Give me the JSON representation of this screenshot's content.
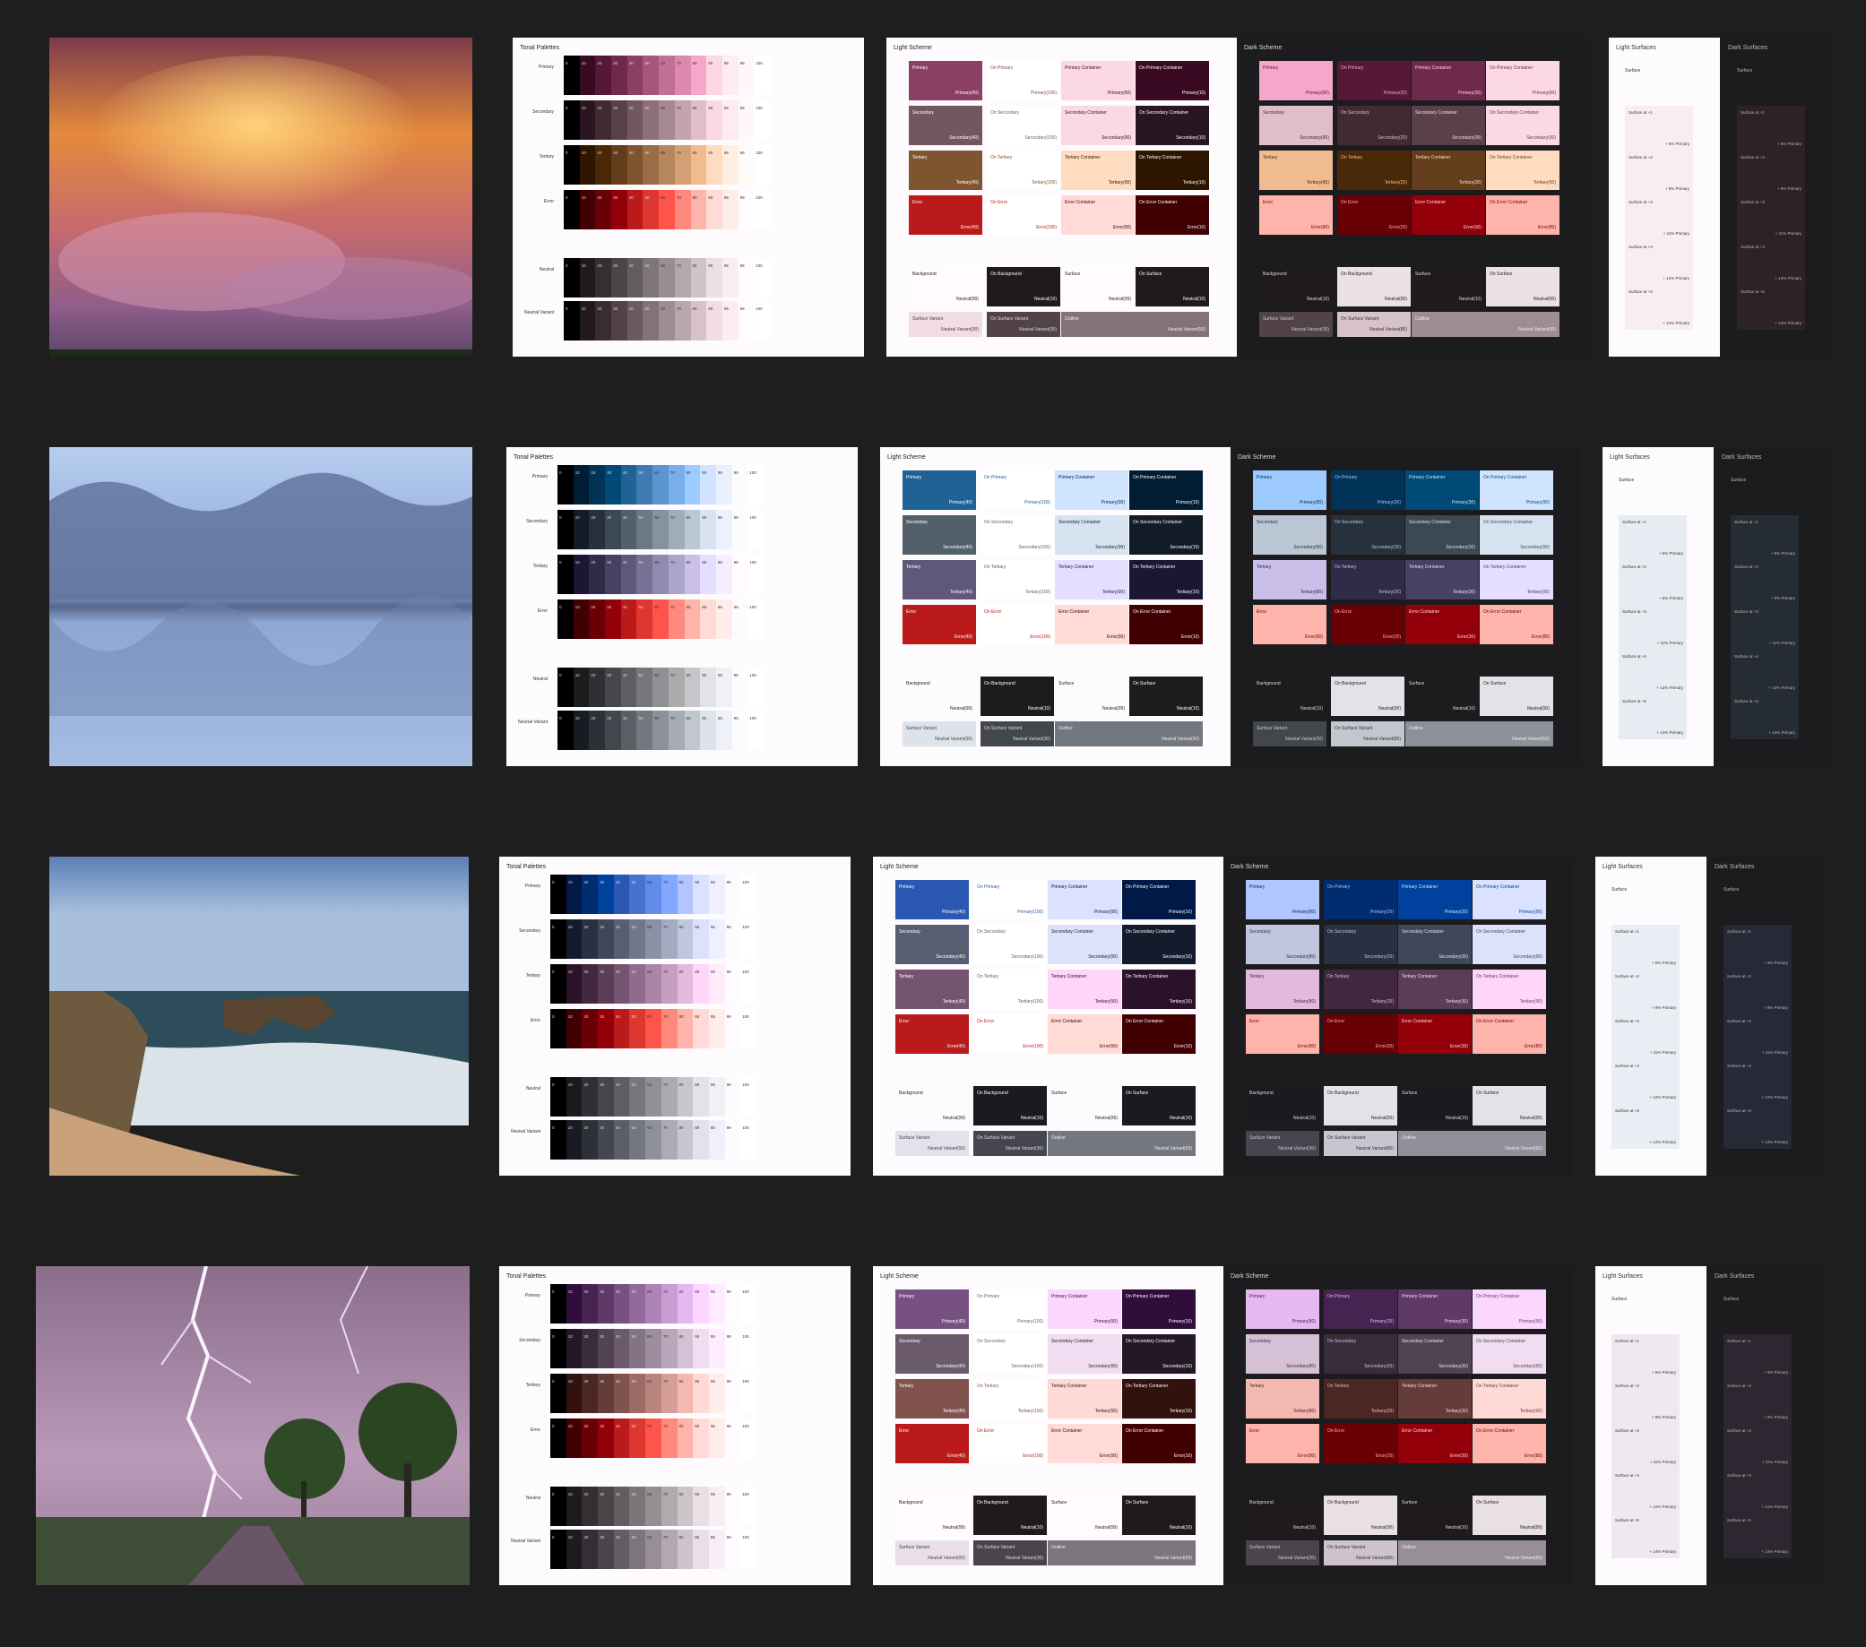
{
  "labels": {
    "tonal_title": "Tonal Palettes",
    "light_scheme_title": "Light Scheme",
    "dark_scheme_title": "Dark Scheme",
    "light_surfaces_title": "Light Surfaces",
    "dark_surfaces_title": "Dark Surfaces",
    "surface": "Surface"
  },
  "tones": [
    "0",
    "10",
    "20",
    "30",
    "40",
    "50",
    "60",
    "70",
    "80",
    "90",
    "95",
    "99",
    "100"
  ],
  "palette_names": [
    "Primary",
    "Secondary",
    "Tertiary",
    "Error",
    "Neutral",
    "Neutral Variant"
  ],
  "surface_levels": [
    {
      "name": "Surface at +1",
      "note": "+ 5% Primary"
    },
    {
      "name": "Surface at +2",
      "note": "+ 8% Primary"
    },
    {
      "name": "Surface at +3",
      "note": "+ 11% Primary"
    },
    {
      "name": "Surface at +4",
      "note": "+ 12% Primary"
    },
    {
      "name": "Surface at +5",
      "note": "+ 14% Primary"
    }
  ],
  "roles_light": [
    {
      "name": "Primary",
      "tone": "Primary(40)"
    },
    {
      "name": "On Primary",
      "tone": "Primary(100)"
    },
    {
      "name": "Primary Container",
      "tone": "Primary(90)"
    },
    {
      "name": "On Primary Container",
      "tone": "Primary(10)"
    },
    {
      "name": "Secondary",
      "tone": "Secondary(40)"
    },
    {
      "name": "On Secondary",
      "tone": "Secondary(100)"
    },
    {
      "name": "Secondary Container",
      "tone": "Secondary(90)"
    },
    {
      "name": "On Secondary Container",
      "tone": "Secondary(10)"
    },
    {
      "name": "Tertiary",
      "tone": "Tertiary(40)"
    },
    {
      "name": "On Tertiary",
      "tone": "Tertiary(100)"
    },
    {
      "name": "Tertiary Container",
      "tone": "Tertiary(90)"
    },
    {
      "name": "On Tertiary Container",
      "tone": "Tertiary(10)"
    },
    {
      "name": "Error",
      "tone": "Error(40)"
    },
    {
      "name": "On Error",
      "tone": "Error(100)"
    },
    {
      "name": "Error Container",
      "tone": "Error(90)"
    },
    {
      "name": "On Error Container",
      "tone": "Error(10)"
    },
    {
      "name": "Background",
      "tone": "Neutral(99)"
    },
    {
      "name": "On Background",
      "tone": "Neutral(10)"
    },
    {
      "name": "Surface",
      "tone": "Neutral(99)"
    },
    {
      "name": "On Surface",
      "tone": "Neutral(10)"
    },
    {
      "name": "Surface Variant",
      "tone": "Neutral Variant(90)"
    },
    {
      "name": "On Surface Variant",
      "tone": "Neutral Variant(30)"
    },
    {
      "name": "Outline",
      "tone": "Neutral Variant(50)"
    }
  ],
  "roles_dark": [
    {
      "name": "Primary",
      "tone": "Primary(80)"
    },
    {
      "name": "On Primary",
      "tone": "Primary(20)"
    },
    {
      "name": "Primary Container",
      "tone": "Primary(30)"
    },
    {
      "name": "On Primary Container",
      "tone": "Primary(90)"
    },
    {
      "name": "Secondary",
      "tone": "Secondary(80)"
    },
    {
      "name": "On Secondary",
      "tone": "Secondary(20)"
    },
    {
      "name": "Secondary Container",
      "tone": "Secondary(30)"
    },
    {
      "name": "On Secondary Container",
      "tone": "Secondary(90)"
    },
    {
      "name": "Tertiary",
      "tone": "Tertiary(80)"
    },
    {
      "name": "On Tertiary",
      "tone": "Tertiary(20)"
    },
    {
      "name": "Tertiary Container",
      "tone": "Tertiary(30)"
    },
    {
      "name": "On Tertiary Container",
      "tone": "Tertiary(90)"
    },
    {
      "name": "Error",
      "tone": "Error(80)"
    },
    {
      "name": "On Error",
      "tone": "Error(20)"
    },
    {
      "name": "Error Container",
      "tone": "Error(30)"
    },
    {
      "name": "On Error Container",
      "tone": "Error(80)"
    },
    {
      "name": "Background",
      "tone": "Neutral(10)"
    },
    {
      "name": "On Background",
      "tone": "Neutral(90)"
    },
    {
      "name": "Surface",
      "tone": "Neutral(10)"
    },
    {
      "name": "On Surface",
      "tone": "Neutral(90)"
    },
    {
      "name": "Surface Variant",
      "tone": "Neutral Variant(30)"
    },
    {
      "name": "On Surface Variant",
      "tone": "Neutral Variant(80)"
    },
    {
      "name": "Outline",
      "tone": "Neutral Variant(60)"
    }
  ],
  "rows": [
    {
      "photo": "sunset-storm-clouds",
      "colors": {
        "primary": [
          "#000000",
          "#3a0a22",
          "#551836",
          "#6f2a4b",
          "#8b3f62",
          "#a6567b",
          "#c26f94",
          "#dd89ae",
          "#f4a7c8",
          "#fbd8e4",
          "#fdecf1",
          "#fff8f9",
          "#ffffff"
        ],
        "secondary": [
          "#000000",
          "#2a1620",
          "#412a34",
          "#59404a",
          "#725761",
          "#8c6f7a",
          "#a78994",
          "#c3a3ae",
          "#dfbec9",
          "#fbd9e4",
          "#fdedf1",
          "#fff8f9",
          "#ffffff"
        ],
        "tertiary": [
          "#000000",
          "#2e1500",
          "#4a2908",
          "#643e1c",
          "#7f5530",
          "#9a6d46",
          "#b6865d",
          "#d3a076",
          "#f0bb8f",
          "#ffdcc0",
          "#ffeee2",
          "#fffbf8",
          "#ffffff"
        ],
        "error": [
          "#000000",
          "#410002",
          "#690005",
          "#93000a",
          "#ba1a1a",
          "#de3730",
          "#ff5449",
          "#ff897d",
          "#ffb4ab",
          "#ffdad6",
          "#ffedea",
          "#fffbff",
          "#ffffff"
        ],
        "neutral": [
          "#000000",
          "#201a1c",
          "#352f31",
          "#4c4547",
          "#645c5f",
          "#7e7577",
          "#988e91",
          "#b3a9ab",
          "#cfc4c6",
          "#ebe0e2",
          "#faeef0",
          "#fffbff",
          "#ffffff"
        ],
        "neutral_variant": [
          "#000000",
          "#23191d",
          "#392d32",
          "#514348",
          "#695b60",
          "#837378",
          "#9e8d92",
          "#b9a7ad",
          "#d6c2c8",
          "#f2dde4",
          "#ffecf1",
          "#fffbff",
          "#ffffff"
        ],
        "light_surface": "#f8eef2",
        "dark_surface": "#2d2326"
      }
    },
    {
      "photo": "frozen-river-trees",
      "colors": {
        "primary": [
          "#000000",
          "#001d34",
          "#003355",
          "#004a78",
          "#1f6296",
          "#3f7bb2",
          "#5c95ce",
          "#78afea",
          "#9dcaff",
          "#d0e4ff",
          "#e9f1ff",
          "#fcfcff",
          "#ffffff"
        ],
        "secondary": [
          "#000000",
          "#111c26",
          "#26313c",
          "#3c4853",
          "#535f6b",
          "#6c7884",
          "#86929e",
          "#a0acb9",
          "#bcc7d5",
          "#d8e3f1",
          "#ebf1ff",
          "#fcfcff",
          "#ffffff"
        ],
        "tertiary": [
          "#000000",
          "#1b1633",
          "#312b4a",
          "#474162",
          "#5f587b",
          "#787195",
          "#928ab0",
          "#ada4cb",
          "#c9bfe8",
          "#e5deff",
          "#f4eeff",
          "#fffbff",
          "#ffffff"
        ],
        "error": [
          "#000000",
          "#410002",
          "#690005",
          "#93000a",
          "#ba1a1a",
          "#de3730",
          "#ff5449",
          "#ff897d",
          "#ffb4ab",
          "#ffdad6",
          "#ffedea",
          "#fcfcff",
          "#ffffff"
        ],
        "neutral": [
          "#000000",
          "#1a1c1e",
          "#2f3033",
          "#45474a",
          "#5d5e61",
          "#76777a",
          "#909094",
          "#ababae",
          "#c6c6ca",
          "#e3e2e6",
          "#f1f0f4",
          "#fcfcff",
          "#ffffff"
        ],
        "neutral_variant": [
          "#000000",
          "#171c22",
          "#2c3138",
          "#42474e",
          "#5a5f66",
          "#73777f",
          "#8c9199",
          "#a7abb3",
          "#c2c7cf",
          "#dee3eb",
          "#eef1fa",
          "#fcfcff",
          "#ffffff"
        ],
        "light_surface": "#e6ecf1",
        "dark_surface": "#252c33"
      }
    },
    {
      "photo": "coastal-rock-arch",
      "colors": {
        "primary": [
          "#000000",
          "#001946",
          "#002c70",
          "#00419d",
          "#2b58b3",
          "#4772ce",
          "#628ce9",
          "#82a7ff",
          "#b1c5ff",
          "#dae2ff",
          "#eef0ff",
          "#fefbff",
          "#ffffff"
        ],
        "secondary": [
          "#000000",
          "#141b2c",
          "#293042",
          "#3f4759",
          "#575e71",
          "#70778b",
          "#8a90a5",
          "#a4abc1",
          "#c0c6dd",
          "#dce2f9",
          "#eef0ff",
          "#fefbff",
          "#ffffff"
        ],
        "tertiary": [
          "#000000",
          "#2b122b",
          "#422741",
          "#5b3d58",
          "#745471",
          "#8f6c8b",
          "#aa85a5",
          "#c69fc0",
          "#e3badc",
          "#ffd6f8",
          "#ffebf9",
          "#fffbff",
          "#ffffff"
        ],
        "error": [
          "#000000",
          "#410002",
          "#690005",
          "#93000a",
          "#ba1a1a",
          "#de3730",
          "#ff5449",
          "#ff897d",
          "#ffb4ab",
          "#ffdad6",
          "#ffedea",
          "#fffbff",
          "#ffffff"
        ],
        "neutral": [
          "#000000",
          "#1b1b1f",
          "#303034",
          "#46464a",
          "#5e5e62",
          "#77767a",
          "#919094",
          "#acaaaf",
          "#c7c6ca",
          "#e4e2e6",
          "#f2f0f4",
          "#fefbff",
          "#ffffff"
        ],
        "neutral_variant": [
          "#000000",
          "#191b23",
          "#2e3038",
          "#45464f",
          "#5c5e67",
          "#757780",
          "#8f909a",
          "#aaabb4",
          "#c5c6d0",
          "#e1e2ec",
          "#f0f0fa",
          "#fefbff",
          "#ffffff"
        ],
        "light_surface": "#ebedf5",
        "dark_surface": "#262a36"
      }
    },
    {
      "photo": "lightning-over-road",
      "colors": {
        "primary": [
          "#000000",
          "#300d3a",
          "#472351",
          "#5f3a69",
          "#785183",
          "#92699d",
          "#ad83b8",
          "#c99dd4",
          "#e5b8f1",
          "#fbd7ff",
          "#feebff",
          "#fffbff",
          "#ffffff"
        ],
        "secondary": [
          "#000000",
          "#241826",
          "#3a2c3c",
          "#514353",
          "#6a5a6b",
          "#837385",
          "#9e8c9f",
          "#b9a6ba",
          "#d5c1d6",
          "#f2dcf2",
          "#ffebff",
          "#fffbff",
          "#ffffff"
        ],
        "tertiary": [
          "#000000",
          "#32120f",
          "#4b2723",
          "#653c37",
          "#80534d",
          "#9c6b64",
          "#b8847d",
          "#d59e96",
          "#f3b8b0",
          "#ffdad5",
          "#ffedea",
          "#fffbff",
          "#ffffff"
        ],
        "error": [
          "#000000",
          "#410002",
          "#690005",
          "#93000a",
          "#ba1a1a",
          "#de3730",
          "#ff5449",
          "#ff897d",
          "#ffb4ab",
          "#ffdad6",
          "#ffedea",
          "#fffbff",
          "#ffffff"
        ],
        "neutral": [
          "#000000",
          "#1e1a1d",
          "#332f32",
          "#4a4548",
          "#625d60",
          "#7b7579",
          "#958f93",
          "#b0a9ad",
          "#ccc4c9",
          "#e9e0e4",
          "#f7eef3",
          "#fffbff",
          "#ffffff"
        ],
        "neutral_variant": [
          "#000000",
          "#1f1a20",
          "#352f35",
          "#4c444c",
          "#645c64",
          "#7d747d",
          "#978e97",
          "#b2a8b2",
          "#cec3cd",
          "#eadfe9",
          "#f9edf7",
          "#fffbff",
          "#ffffff"
        ],
        "light_surface": "#f0e8f0",
        "dark_surface": "#2e2630"
      }
    }
  ]
}
